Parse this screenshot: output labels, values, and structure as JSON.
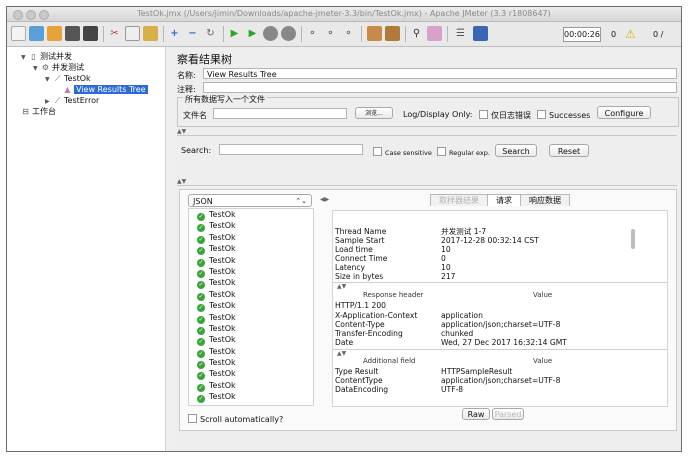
{
  "window": {
    "title": "TestOk.jmx (/Users/jimin/Downloads/apache-jmeter-3.3/bin/TestOk.jmx) - Apache JMeter (3.3 r1808647)"
  },
  "toolbar": {
    "timer": "00:00:26",
    "warning_count": "0",
    "threads": "0 /"
  },
  "tree": {
    "nodes": [
      {
        "label": "测试并发",
        "icon": "testplan-icon",
        "arrow": "▼"
      },
      {
        "label": "并发测试",
        "icon": "gear-icon",
        "arrow": "▼"
      },
      {
        "label": "TestOk",
        "icon": "pipette-icon",
        "arrow": "▼"
      },
      {
        "label": "View Results Tree",
        "icon": "listener-icon",
        "arrow": ""
      },
      {
        "label": "TestError",
        "icon": "pipette-icon",
        "arrow": "▶"
      },
      {
        "label": "工作台",
        "icon": "workbench-icon",
        "arrow": ""
      }
    ]
  },
  "panel": {
    "title": "察看结果树",
    "name_label": "名称:",
    "name_value": "View Results Tree",
    "comment_label": "注释:",
    "comment_value": "",
    "file_group_title": "所有数据写入一个文件",
    "filename_label": "文件名",
    "filename_value": "",
    "browse_label": "浏览...",
    "logdisplay_label": "Log/Display Only:",
    "errors_only_label": "仅日志错误",
    "successes_label": "Successes",
    "configure_label": "Configure"
  },
  "search": {
    "label": "Search:",
    "value": "",
    "case_sensitive_label": "Case sensitive",
    "regex_label": "Regular exp.",
    "search_button": "Search",
    "reset_button": "Reset"
  },
  "results": {
    "renderer": "JSON",
    "samples": [
      "TestOk",
      "TestOk",
      "TestOk",
      "TestOk",
      "TestOk",
      "TestOk",
      "TestOk",
      "TestOk",
      "TestOk",
      "TestOk",
      "TestOk",
      "TestOk",
      "TestOk",
      "TestOk",
      "TestOk",
      "TestOk",
      "TestOk"
    ],
    "scroll_auto_label": "Scroll automatically?",
    "tabs": [
      "取样器结果",
      "请求",
      "响应数据"
    ],
    "sampler_fields": [
      {
        "k": "Thread Name",
        "v": "并发测试 1-7"
      },
      {
        "k": "Sample Start",
        "v": "2017-12-28 00:32:14 CST"
      },
      {
        "k": "Load time",
        "v": "10"
      },
      {
        "k": "Connect Time",
        "v": "0"
      },
      {
        "k": "Latency",
        "v": "10"
      },
      {
        "k": "Size in bytes",
        "v": "217"
      }
    ],
    "response_header_col": "Response header",
    "value_col": "Value",
    "response_headers": [
      {
        "k": "HTTP/1.1 200",
        "v": ""
      },
      {
        "k": "X-Application-Context",
        "v": "application"
      },
      {
        "k": "Content-Type",
        "v": "application/json;charset=UTF-8"
      },
      {
        "k": "Transfer-Encoding",
        "v": "chunked"
      },
      {
        "k": "Date",
        "v": "Wed, 27 Dec 2017 16:32:14 GMT"
      }
    ],
    "additional_field_col": "Additional field",
    "additional_fields": [
      {
        "k": "Type Result",
        "v": "HTTPSampleResult"
      },
      {
        "k": "ContentType",
        "v": "application/json;charset=UTF-8"
      },
      {
        "k": "DataEncoding",
        "v": "UTF-8"
      }
    ],
    "raw_tab": "Raw",
    "parsed_tab": "Parsed"
  }
}
